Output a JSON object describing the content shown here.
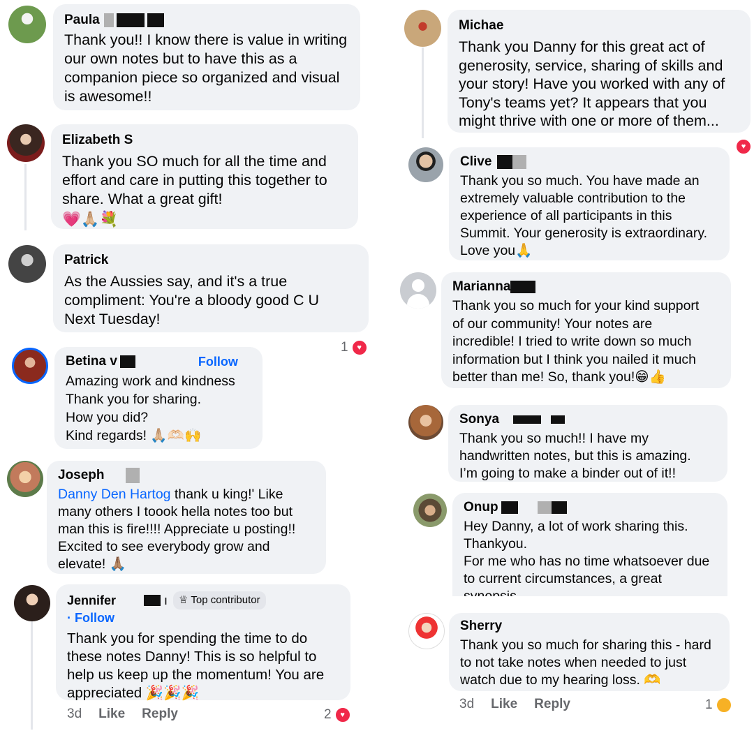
{
  "left": {
    "c1": {
      "name": "Paula",
      "text": "Thank you!! I know there is value in writing\nour own notes but to have this as a\ncompanion piece so organized and visual\nis awesome!!"
    },
    "c2": {
      "name": "Elizabeth S",
      "text": "Thank you SO much for all the time and\neffort and care in putting this together to\nshare. What a great gift!",
      "emojis": "💗🙏🏼💐"
    },
    "c3": {
      "name": "Patrick",
      "text": "As the Aussies say, and it's a true\ncompliment: You're a bloody good C U\nNext Tuesday!",
      "reaction_count": "1"
    },
    "c4": {
      "name": "Betina v",
      "follow": "Follow",
      "text": "Amazing work and kindness\nThank you for sharing.\nHow you did?\nKind regards! 🙏🏼🫶🏻🙌"
    },
    "c5": {
      "name": "Joseph",
      "mention": "Danny Den Hartog",
      "text": " thank u king!' Like\nmany others I toook hella notes too but\nman this is fire!!!! Appreciate u posting!!\nExcited to see everybody grow and\nelevate! 🙏🏽"
    },
    "c6": {
      "name": "Jennifer",
      "badge": "Top contributor",
      "follow": "· Follow",
      "text": "Thank you for spending the time to do\nthese notes Danny! This is so helpful to\nhelp us keep up the momentum! You are\nappreciated 🎉🎉🎉",
      "time": "3d",
      "like": "Like",
      "reply": "Reply",
      "reaction_count": "2"
    }
  },
  "right": {
    "c1": {
      "name": "Michae",
      "text": "Thank you Danny for this great act of\ngenerosity, service, sharing of skills and\nyour story! Have you worked with any of\nTony's teams yet? It appears that you\nmight thrive with one or more of them..."
    },
    "c2": {
      "name": "Clive",
      "text": "Thank you so much. You have made an\nextremely valuable contribution to the\nexperience of all participants in this\nSummit. Your generosity is extraordinary.\nLove you🙏"
    },
    "c3": {
      "name": "Marianna",
      "text": "Thank you so much for your kind support\nof our community! Your notes are\nincredible! I tried to write down so much\ninformation but I think you nailed it much\nbetter than me! So, thank you!😁👍"
    },
    "c4": {
      "name": "Sonya",
      "text": "Thank you so much!! I have my\nhandwritten notes, but this is amazing.\nI’m going to make a binder out of it!!"
    },
    "c5": {
      "name": "Onup",
      "text": "Hey Danny, a lot of work sharing this.\nThankyou.\nFor me who has no time whatsoever due\nto current circumstances, a great\nsynopsis."
    },
    "c6": {
      "name": "Sherry",
      "text": "Thank you so much for sharing this - hard\nto not take notes when needed to just\nwatch due to my hearing loss. 🫶",
      "time": "3d",
      "like": "Like",
      "reply": "Reply",
      "reaction_count": "1"
    }
  },
  "colors": {
    "bubble": "#f0f2f5",
    "link": "#0866ff",
    "heart": "#f02849",
    "meta": "#65676b"
  }
}
